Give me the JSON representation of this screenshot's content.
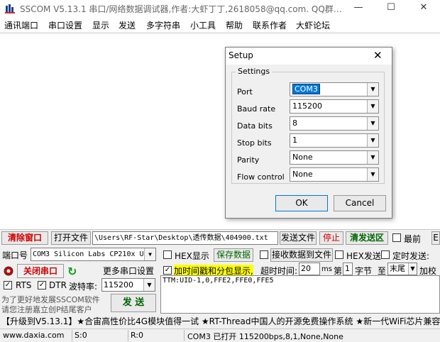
{
  "window": {
    "title": "SSCOM V5.13.1 串口/网络数据调试器,作者:大虾丁丁,2618058@qq.com. QQ群…",
    "min_glyph": "—",
    "max_glyph": "☐",
    "close_glyph": "✕"
  },
  "menu": [
    "通讯端口",
    "串口设置",
    "显示",
    "发送",
    "多字符串",
    "小工具",
    "帮助",
    "联系作者",
    "大虾论坛"
  ],
  "dialog": {
    "title": "Setup",
    "group_label": "Settings",
    "rows": [
      {
        "label": "Port",
        "value": "COM3"
      },
      {
        "label": "Baud rate",
        "value": "115200"
      },
      {
        "label": "Data bits",
        "value": "8"
      },
      {
        "label": "Stop bits",
        "value": "1"
      },
      {
        "label": "Parity",
        "value": "None"
      },
      {
        "label": "Flow control",
        "value": "None"
      }
    ],
    "ok_label": "OK",
    "cancel_label": "Cancel"
  },
  "toolbar": {
    "clear_label": "清除窗口",
    "open_file_label": "打开文件",
    "file_path": "\\Users\\RF-Star\\Desktop\\透传数据\\404900.txt",
    "send_file_label": "发送文件",
    "stop_label": "停止",
    "clear_send_label": "清发送区",
    "topmost_label": "最前",
    "english_glyph": "E"
  },
  "controls": {
    "port_label": "端口号",
    "port_value": "COM3 Silicon Labs CP210x U",
    "hex_display_label": "HEX显示",
    "save_data_label": "保存数据",
    "recv_to_file_label": "接收数据到文件",
    "hex_send_label": "HEX发送",
    "timed_send_label": "定时发送:",
    "close_port_label": "关闭串口",
    "more_settings_label": "更多串口设置",
    "timestamp_label": "加时间戳和分包显示,",
    "timeout_label": "超时时间:",
    "timeout_value": "20",
    "timeout_unit": "ms",
    "byte_prefix": "第",
    "byte_index": "1",
    "byte_label": "字节",
    "to_label": "至",
    "end_value": "末尾",
    "checksum_label": "加校",
    "rts_label": "RTS",
    "dtr_label": "DTR",
    "baud_label": "波特率:",
    "baud_value": "115200",
    "send_text": "TTM:UID-1,0,FFE2,FFE0,FFE5",
    "promo_line1": "为了更好地发展SSCOM软件",
    "promo_line2": "请您注册嘉立创P结尾客户",
    "send_label": "发 送"
  },
  "ticker": "【升级到V5.13.1】★合宙高性价比4G模块值得一试 ★RT-Thread中国人的开源免费操作系统 ★新一代WiFi芯片兼容",
  "status": {
    "website": "www.daxia.com",
    "sent": "S:0",
    "received": "R:0",
    "port_status": "COM3 已打开  115200bps,8,1,None,None"
  },
  "colors": {
    "red_text": "#cc0000",
    "green_text": "#006600",
    "yellow_highlight": "#ffff00",
    "selection": "#0078d7"
  }
}
